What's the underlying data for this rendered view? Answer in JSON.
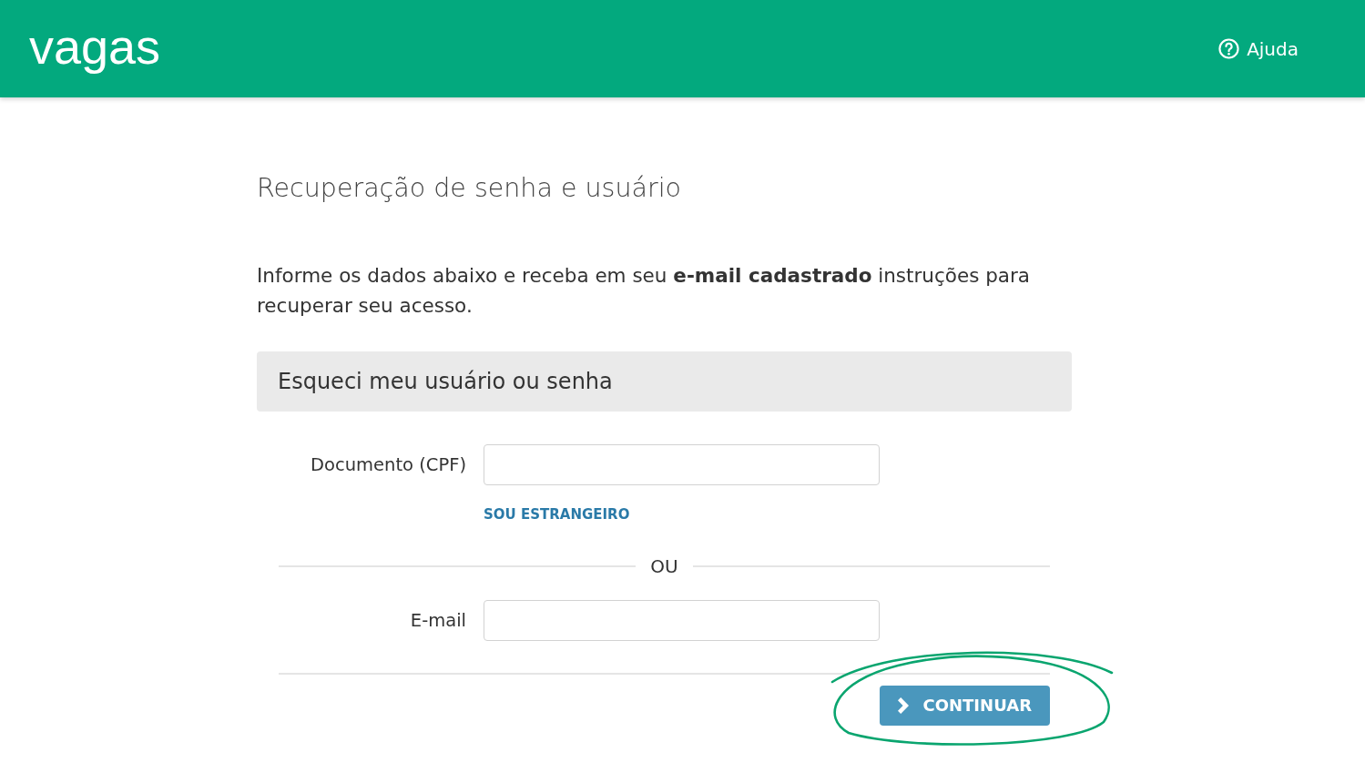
{
  "header": {
    "logo": "vagas",
    "help_link": "Ajuda"
  },
  "title": "Recuperação de senha e usuário",
  "intro": "Informe os dados abaixo e receba em seu **e-mail cadastrado** instruções para recuperar seu acesso.",
  "section": {
    "title": "Esqueci meu usuário ou senha",
    "document_field": {
      "label": "Documento (CPF)"
    },
    "foreigner_link": "SOU ESTRANGEIRO",
    "separator": "OU",
    "email_field": {
      "label": "E-mail"
    },
    "submit_button": {
      "label": "CONTINUAR",
      "highlighted": true
    }
  }
}
